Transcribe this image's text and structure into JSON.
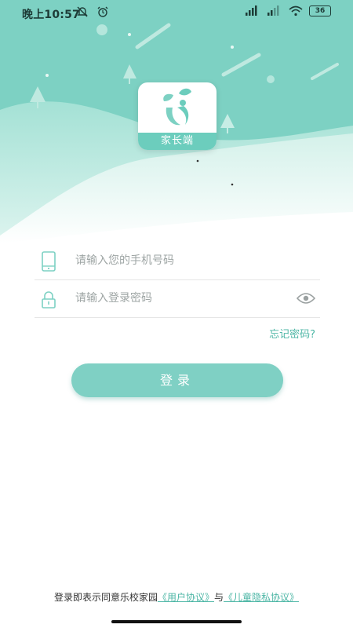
{
  "status_bar": {
    "time": "晚上10:57",
    "battery": "36"
  },
  "logo": {
    "label": "家长端",
    "icon": "sprout-person-icon"
  },
  "form": {
    "phone_placeholder": "请输入您的手机号码",
    "password_placeholder": "请输入登录密码",
    "forgot_label": "忘记密码?",
    "login_label": "登录"
  },
  "agreement": {
    "prefix": "登录即表示同意乐校家园",
    "user_agreement": "《用户协议》",
    "conjunction": "与",
    "privacy_agreement": "《儿童隐私协议》"
  },
  "colors": {
    "accent": "#7dd1c3",
    "link": "#4cb6a5"
  }
}
